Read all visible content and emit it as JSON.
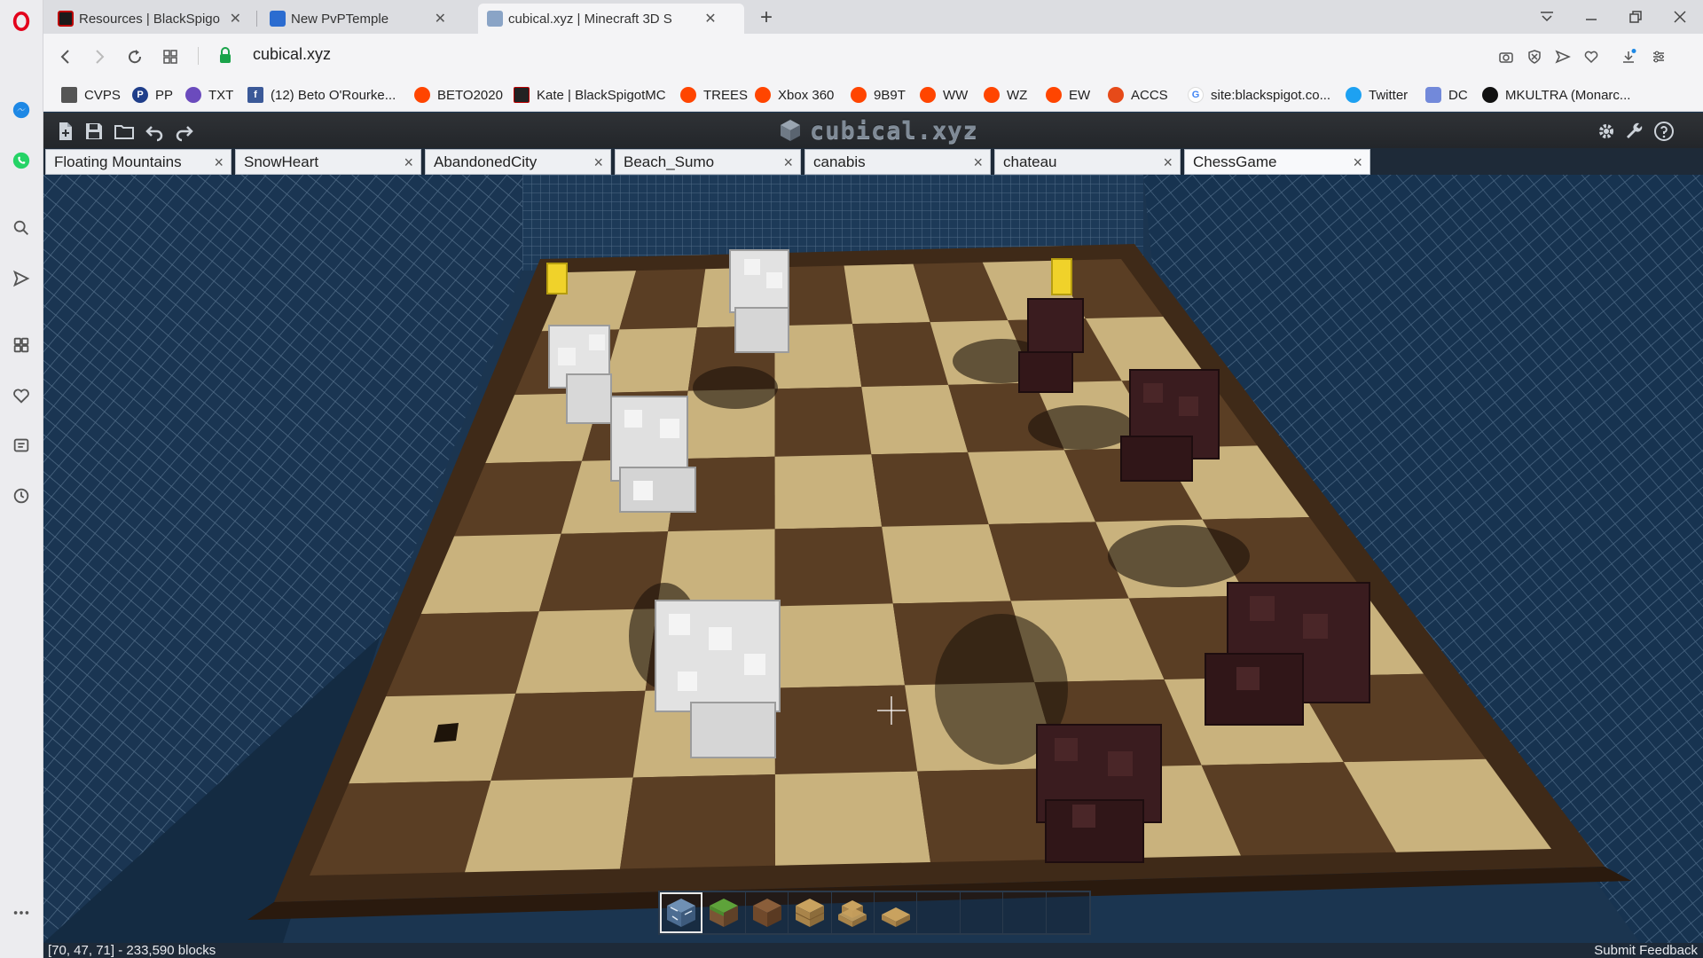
{
  "browser": {
    "tabs": [
      {
        "title": "Resources | BlackSpigotMC",
        "close": "✕"
      },
      {
        "title": "New PvPTemple",
        "close": "✕"
      },
      {
        "title": "cubical.xyz | Minecraft 3D S",
        "close": "✕"
      }
    ],
    "new_tab": "+",
    "url": "cubical.xyz"
  },
  "bookmarks": [
    {
      "label": "CVPS",
      "color": "#555555"
    },
    {
      "label": "PP",
      "color": "#1f3e8a"
    },
    {
      "label": "TXT",
      "color": "#6b4bbd"
    },
    {
      "label": "(12) Beto O'Rourke...",
      "color": "#3b5998"
    },
    {
      "label": "BETO2020",
      "color": "#ff4500"
    },
    {
      "label": "Kate | BlackSpigotMC",
      "color": "#222222"
    },
    {
      "label": "TREES",
      "color": "#ff4500"
    },
    {
      "label": "Xbox 360",
      "color": "#ff4500"
    },
    {
      "label": "9B9T",
      "color": "#ff4500"
    },
    {
      "label": "WW",
      "color": "#ff4500"
    },
    {
      "label": "WZ",
      "color": "#ff4500"
    },
    {
      "label": "EW",
      "color": "#ff4500"
    },
    {
      "label": "ACCS",
      "color": "#e64a19"
    },
    {
      "label": "site:blackspigot.co...",
      "color": "#4285f4"
    },
    {
      "label": "Twitter",
      "color": "#1da1f2"
    },
    {
      "label": "DC",
      "color": "#7289da"
    },
    {
      "label": "MKULTRA (Monarc...",
      "color": "#111111"
    }
  ],
  "app": {
    "brand": "cubical.xyz",
    "tabs": [
      {
        "label": "Floating Mountains",
        "close": "×"
      },
      {
        "label": "SnowHeart",
        "close": "×"
      },
      {
        "label": "AbandonedCity",
        "close": "×"
      },
      {
        "label": "Beach_Sumo",
        "close": "×"
      },
      {
        "label": "canabis",
        "close": "×"
      },
      {
        "label": "chateau",
        "close": "×"
      },
      {
        "label": "ChessGame",
        "close": "×"
      }
    ],
    "status": {
      "coords": "[70, 47, 71] - 233,590 blocks",
      "feedback": "Submit Feedback"
    }
  },
  "colors": {
    "light_square": "#c9b27d",
    "dark_square": "#5a3e24",
    "frame": "#3f2a18",
    "white_piece": "#e2e2e2",
    "black_piece": "#3a1c1f",
    "wall": "#18334f",
    "accent_gold": "#f0d22a"
  }
}
